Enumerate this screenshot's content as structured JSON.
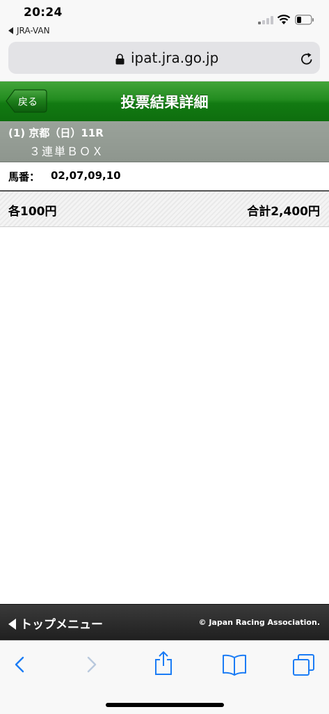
{
  "status_bar": {
    "time": "20:24",
    "back_app": "JRA-VAN"
  },
  "browser": {
    "url": "ipat.jra.go.jp"
  },
  "header": {
    "back_label": "戻る",
    "title": "投票結果詳細"
  },
  "race": {
    "line": "(1) 京都（日）11R",
    "bet_type": "３連単ＢＯＸ"
  },
  "horses": {
    "label": "馬番：",
    "values": "02,07,09,10"
  },
  "amounts": {
    "each": "各100円",
    "total": "合計2,400円"
  },
  "footer": {
    "top_menu": "トップメニュー",
    "copyright": "© Japan Racing Association."
  },
  "colors": {
    "header_green": "#1f861c",
    "race_band": "#949c94",
    "toolbar_blue": "#1b7cf5"
  }
}
